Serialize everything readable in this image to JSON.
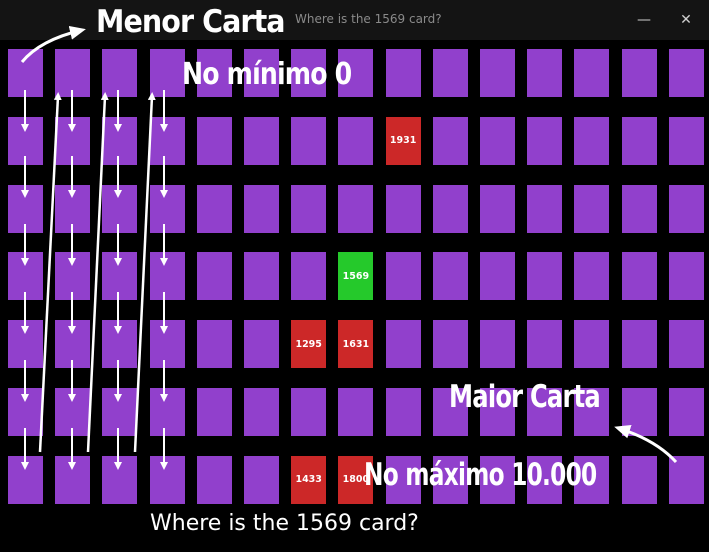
{
  "window": {
    "title": "Where is the 1569 card?",
    "minimize_glyph": "—",
    "close_glyph": "✕"
  },
  "board": {
    "rows": 7,
    "cols": 15,
    "card_color": "#9140cc",
    "revealed_color": "#cc2828",
    "found_color": "#25c92b",
    "revealed_cards": [
      {
        "row": 1,
        "col": 8,
        "value": "1931",
        "state": "revealed"
      },
      {
        "row": 3,
        "col": 7,
        "value": "1569",
        "state": "found"
      },
      {
        "row": 4,
        "col": 6,
        "value": "1295",
        "state": "revealed"
      },
      {
        "row": 4,
        "col": 7,
        "value": "1631",
        "state": "revealed"
      },
      {
        "row": 6,
        "col": 6,
        "value": "1433",
        "state": "revealed"
      },
      {
        "row": 6,
        "col": 7,
        "value": "1800",
        "state": "revealed"
      }
    ]
  },
  "annotations": {
    "menor_carta": "Menor Carta",
    "no_minimo": "No mínimo 0",
    "maior_carta": "Maior Carta",
    "no_maximo": "No máximo 10.000"
  },
  "question": "Where is the 1569 card?"
}
